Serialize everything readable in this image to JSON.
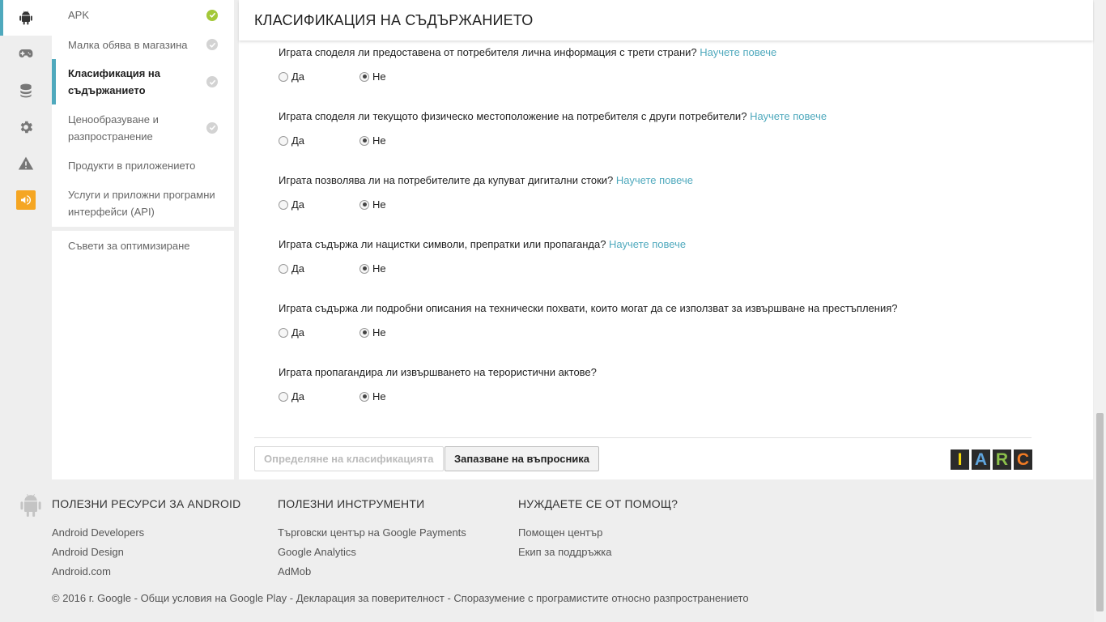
{
  "rail": {
    "items": [
      "android-icon",
      "gamepad-icon",
      "database-icon",
      "gear-icon",
      "warning-icon",
      "megaphone-icon"
    ]
  },
  "nav": {
    "items": [
      {
        "label": "APK",
        "check": "green"
      },
      {
        "label": "Малка обява в магазина",
        "check": "gray"
      },
      {
        "label": "Класификация на съдържанието",
        "check": "gray",
        "active": true
      },
      {
        "label": "Ценообразуване и разпространение",
        "check": "gray"
      },
      {
        "label": "Продукти в приложението",
        "check": "none"
      },
      {
        "label": "Услуги и приложни програмни интерфейси (API)",
        "check": "none"
      }
    ],
    "tips": "Съвети за оптимизиране"
  },
  "main": {
    "title": "КЛАСИФИКАЦИЯ НА СЪДЪРЖАНИЕТО",
    "learn_more": "Научете повече",
    "yes": "Да",
    "no": "Не",
    "questions": [
      {
        "text": "Играта споделя ли предоставена от потребителя лична информация с трети страни?",
        "link": true,
        "answer": "no"
      },
      {
        "text": "Играта споделя ли текущото физическо местоположение на потребителя с други потребители?",
        "link": true,
        "answer": "no"
      },
      {
        "text": "Играта позволява ли на потребителите да купуват дигитални стоки?",
        "link": true,
        "answer": "no"
      },
      {
        "text": "Играта съдържа ли нацистки символи, препратки или пропаганда?",
        "link": true,
        "answer": "no"
      },
      {
        "text": "Играта съдържа ли подробни описания на технически похвати, които могат да се използват за извършване на престъпления?",
        "link": false,
        "answer": "no"
      },
      {
        "text": "Играта пропагандира ли извършването на терористични актове?",
        "link": false,
        "answer": "no"
      }
    ],
    "btn_calc": "Определяне на класификацията",
    "btn_save": "Запазване на въпросника",
    "iarc": [
      "I",
      "A",
      "R",
      "C"
    ],
    "iarc_colors": [
      "#f5d90a",
      "#5fa5de",
      "#8cc04b",
      "#f27b24"
    ]
  },
  "footer": {
    "col1": {
      "title": "ПОЛЕЗНИ РЕСУРСИ ЗА ANDROID",
      "links": [
        "Android Developers",
        "Android Design",
        "Android.com"
      ]
    },
    "col2": {
      "title": "ПОЛЕЗНИ ИНСТРУМЕНТИ",
      "links": [
        "Търговски център на Google Payments",
        "Google Analytics",
        "AdMob"
      ]
    },
    "col3": {
      "title": "НУЖДАЕТЕ СЕ ОТ ПОМОЩ?",
      "links": [
        "Помощен център",
        "Екип за поддръжка"
      ]
    },
    "copyright": "© 2016 г. Google - Общи условия на Google Play - Декларация за поверителност - Споразумение с програмистите относно разпространението"
  },
  "colors": {
    "accent": "#4fa9bd",
    "check_green": "#a3c838",
    "orange": "#f5a623"
  }
}
